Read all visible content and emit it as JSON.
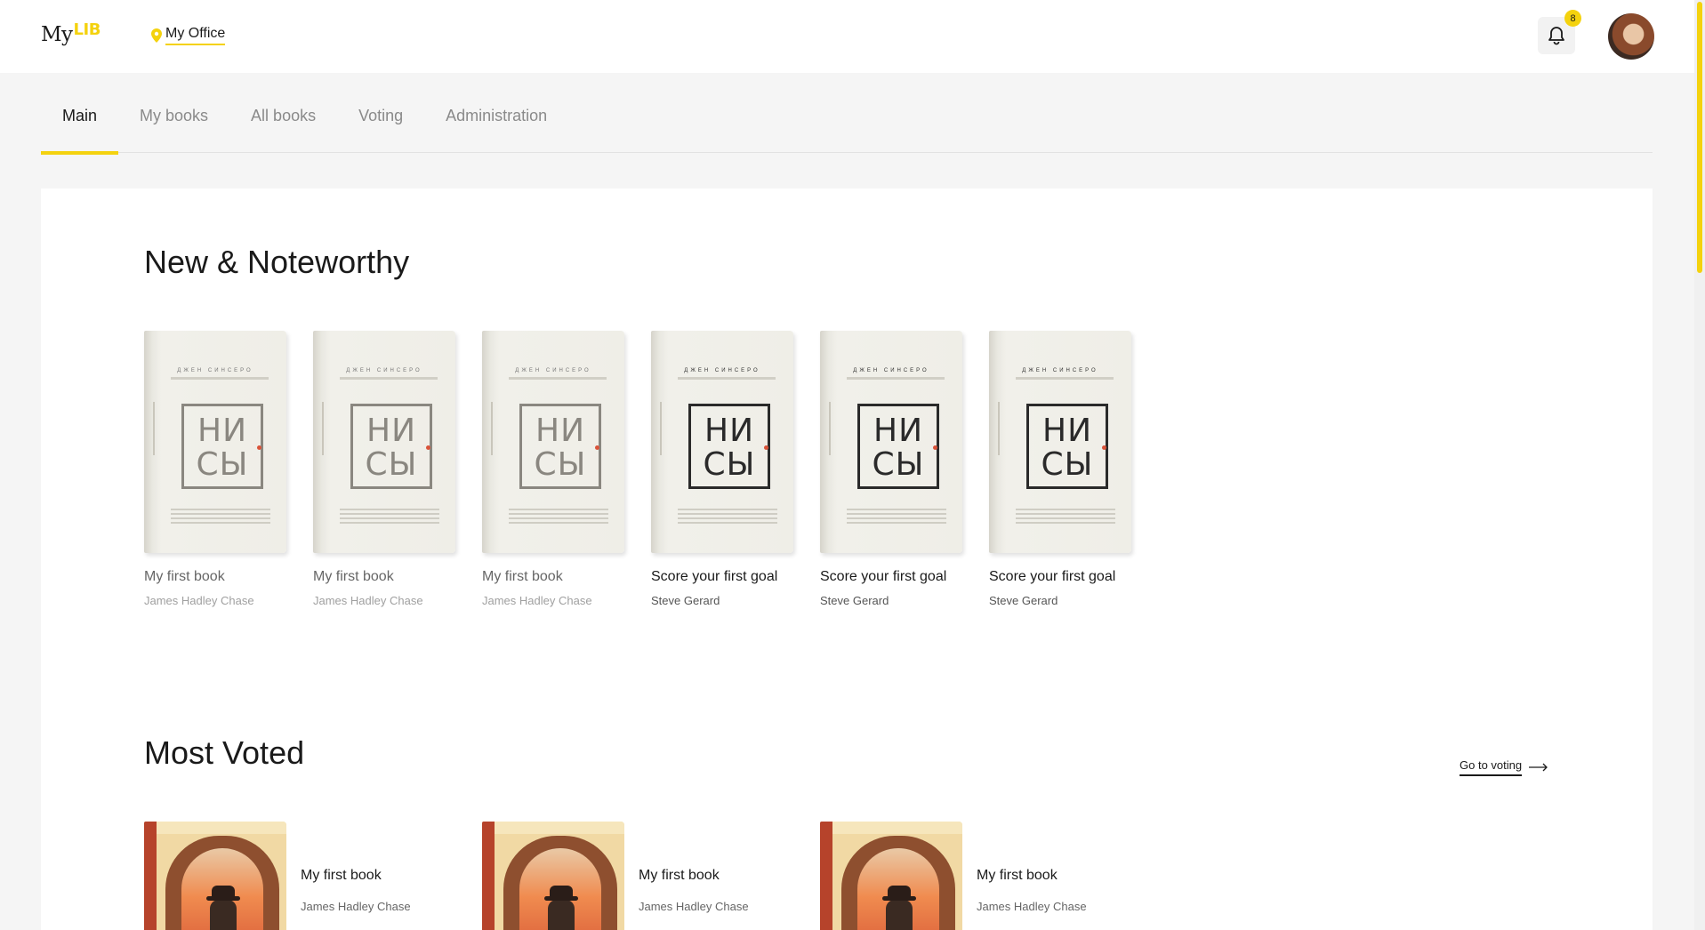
{
  "app": {
    "logo_text": "My",
    "logo_accent": "LIB",
    "office_label": "My Office"
  },
  "header": {
    "notification_count": "8",
    "icons": [
      "location-pin-icon",
      "bell-icon",
      "avatar"
    ]
  },
  "tabs": [
    {
      "label": "Main",
      "active": true
    },
    {
      "label": "My books",
      "active": false
    },
    {
      "label": "All books",
      "active": false
    },
    {
      "label": "Voting",
      "active": false
    },
    {
      "label": "Administration",
      "active": false
    }
  ],
  "new_noteworthy": {
    "title": "New & Noteworthy",
    "books": [
      {
        "title": "My first book",
        "author": "James Hadley Chase",
        "cover_line1": "НИ",
        "cover_line2": "СЫ",
        "cover_author": "ДЖЕН СИНСЕРО"
      },
      {
        "title": "My first book",
        "author": "James Hadley Chase",
        "cover_line1": "НИ",
        "cover_line2": "СЫ",
        "cover_author": "ДЖЕН СИНСЕРО"
      },
      {
        "title": "My first book",
        "author": "James Hadley Chase",
        "cover_line1": "НИ",
        "cover_line2": "СЫ",
        "cover_author": "ДЖЕН СИНСЕРО"
      },
      {
        "title": "Score your first goal",
        "author": "Steve Gerard",
        "cover_line1": "НИ",
        "cover_line2": "СЫ",
        "cover_author": "ДЖЕН СИНСЕРО"
      },
      {
        "title": "Score your first goal",
        "author": "Steve Gerard",
        "cover_line1": "НИ",
        "cover_line2": "СЫ",
        "cover_author": "ДЖЕН СИНСЕРО"
      },
      {
        "title": "Score your first goal",
        "author": "Steve Gerard",
        "cover_line1": "НИ",
        "cover_line2": "СЫ",
        "cover_author": "ДЖЕН СИНСЕРО"
      }
    ]
  },
  "most_voted": {
    "title": "Most Voted",
    "goto_label": "Go to voting",
    "books": [
      {
        "title": "My first book",
        "author": "James Hadley Chase"
      },
      {
        "title": "My first book",
        "author": "James Hadley Chase"
      },
      {
        "title": "My first book",
        "author": "James Hadley Chase"
      }
    ]
  },
  "colors": {
    "accent": "#f4d20e",
    "text": "#1a1a1a",
    "muted": "#8a8a8a",
    "background": "#f5f5f5"
  }
}
